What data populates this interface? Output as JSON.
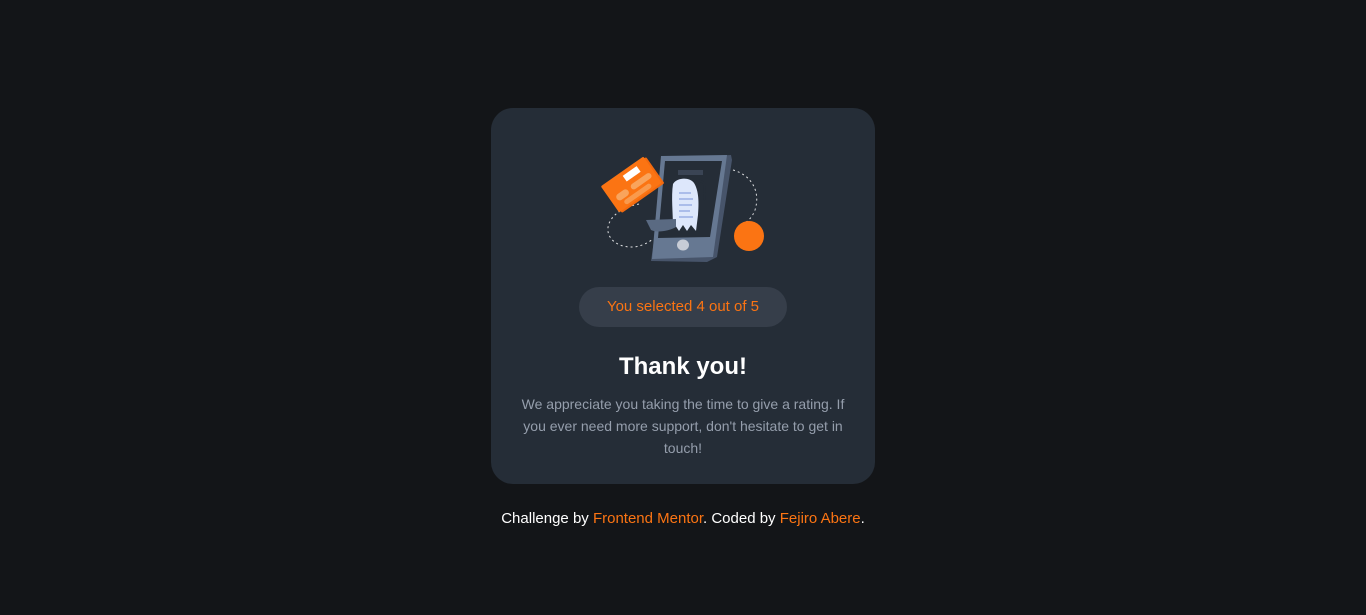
{
  "colors": {
    "page_background": "#131518",
    "card_background": "#252d37",
    "accent": "#fb7413",
    "pill_background": "#363e4a",
    "muted_text": "#959eac",
    "heading_text": "#ffffff"
  },
  "card": {
    "illustration": "payment-receipt-phone-illustration",
    "selected_text": "You selected 4 out of 5",
    "selected_rating": 4,
    "max_rating": 5,
    "title": "Thank you!",
    "message": "We appreciate you taking the time to give a rating. If you ever need more support, don't hesitate to get in touch!"
  },
  "attribution": {
    "prefix": "Challenge by ",
    "challenge_link": "Frontend Mentor",
    "middle": ". Coded by ",
    "author_link": "Fejiro Abere",
    "suffix": "."
  }
}
